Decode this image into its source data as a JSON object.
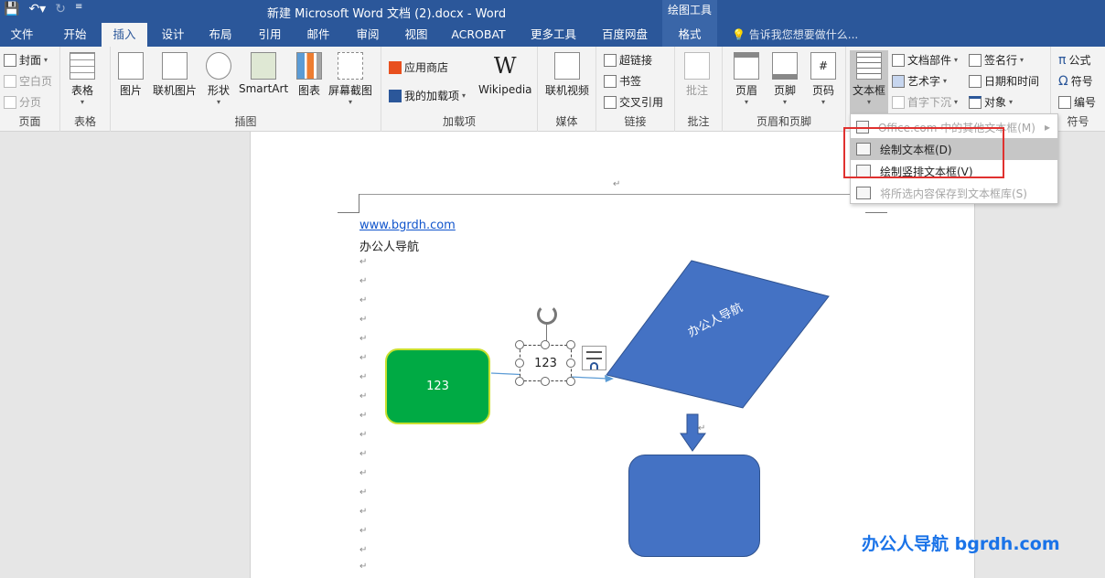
{
  "titlebar": {
    "title": "新建 Microsoft Word 文档 (2).docx - Word",
    "context_group": "绘图工具"
  },
  "tabs": [
    {
      "label": "文件"
    },
    {
      "label": "开始"
    },
    {
      "label": "插入"
    },
    {
      "label": "设计"
    },
    {
      "label": "布局"
    },
    {
      "label": "引用"
    },
    {
      "label": "邮件"
    },
    {
      "label": "审阅"
    },
    {
      "label": "视图"
    },
    {
      "label": "ACROBAT"
    },
    {
      "label": "更多工具"
    },
    {
      "label": "百度网盘"
    },
    {
      "label": "格式"
    }
  ],
  "tell_me": "告诉我您想要做什么...",
  "ribbon": {
    "pages": {
      "label": "页面",
      "cover": "封面",
      "blank": "空白页",
      "break": "分页"
    },
    "table": {
      "label": "表格",
      "btn": "表格"
    },
    "illustrations": {
      "label": "插图",
      "pictures": "图片",
      "online_pictures": "联机图片",
      "shapes": "形状",
      "smartart": "SmartArt",
      "chart": "图表",
      "screenshot": "屏幕截图"
    },
    "addins": {
      "label": "加载项",
      "store": "应用商店",
      "my_addins": "我的加载项",
      "wikipedia": "Wikipedia"
    },
    "media": {
      "label": "媒体",
      "online_video": "联机视频"
    },
    "links": {
      "label": "链接",
      "hyperlink": "超链接",
      "bookmark": "书签",
      "crossref": "交叉引用"
    },
    "comments": {
      "label": "批注",
      "comment": "批注"
    },
    "header_footer": {
      "label": "页眉和页脚",
      "header": "页眉",
      "footer": "页脚",
      "page_number": "页码"
    },
    "text": {
      "textbox": "文本框",
      "quick_parts": "文档部件",
      "wordart": "艺术字",
      "dropcap": "首字下沉",
      "signature": "签名行",
      "datetime": "日期和时间",
      "object": "对象"
    },
    "symbols": {
      "label": "符号",
      "equation": "公式",
      "symbol": "符号",
      "number": "编号"
    }
  },
  "dropdown": {
    "items": [
      {
        "label": "Office.com 中的其他文本框(M)",
        "enabled": false
      },
      {
        "label": "绘制文本框(D)",
        "enabled": true
      },
      {
        "label": "绘制竖排文本框(V)",
        "enabled": true
      },
      {
        "label": "将所选内容保存到文本框库(S)",
        "enabled": false
      }
    ]
  },
  "document": {
    "link": "www.bgrdh.com",
    "line2": "办公人导航",
    "green_shape_text": "123",
    "textbox_text": "123",
    "parallelogram_text": "办公人导航"
  },
  "watermark": "办公人导航  bgrdh.com",
  "colors": {
    "ribbon_blue": "#2b579a",
    "green_shape": "#00aa44",
    "blue_shape": "#4472c4",
    "highlight_red": "#e0312f"
  }
}
